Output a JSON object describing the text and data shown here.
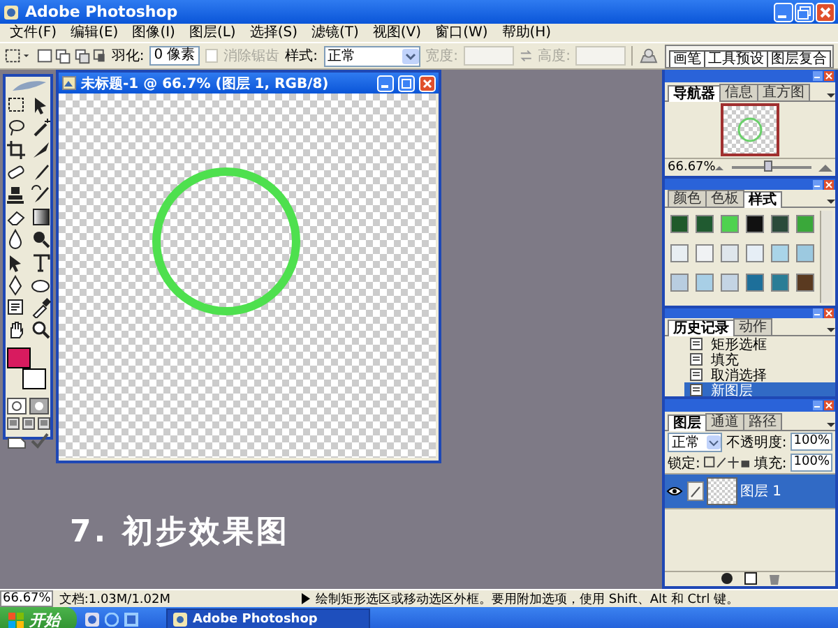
{
  "window": {
    "title": "Adobe Photoshop"
  },
  "menu": [
    "文件(F)",
    "编辑(E)",
    "图像(I)",
    "图层(L)",
    "选择(S)",
    "滤镜(T)",
    "视图(V)",
    "窗口(W)",
    "帮助(H)"
  ],
  "options": {
    "feather_label": "羽化:",
    "feather_value": "0 像素",
    "antialias_label": "消除锯齿",
    "antialias_disabled": true,
    "style_label": "样式:",
    "style_value": "正常",
    "width_label": "宽度:",
    "height_label": "高度:",
    "size_disabled": true,
    "palette_tabs": [
      "画笔",
      "工具预设",
      "图层复合"
    ]
  },
  "toolbox": {
    "colors": [
      {
        "kind": "foreground",
        "color": "#d81b5f"
      },
      {
        "kind": "background",
        "color": "#ffffff"
      }
    ]
  },
  "document": {
    "title": "未标题-1 @ 66.7% (图层 1, RGB/8)"
  },
  "caption": "7. 初步效果图",
  "navigator": {
    "tabs": [
      {
        "label": "导航器",
        "selected": true
      },
      {
        "label": "信息",
        "selected": false
      },
      {
        "label": "直方图",
        "selected": false
      }
    ],
    "zoom": "66.67%",
    "level": 0.45
  },
  "styles": {
    "tabs": [
      {
        "label": "颜色",
        "selected": false
      },
      {
        "label": "色板",
        "selected": false
      },
      {
        "label": "样式",
        "selected": true
      }
    ],
    "swatches": [
      {
        "color": "#1f5a2a"
      },
      {
        "color": "#205a30"
      },
      {
        "color": "#4fd24f"
      },
      {
        "color": "#111111"
      },
      {
        "color": "#2a4a3a"
      },
      {
        "color": "#3aa83a"
      },
      {
        "color": "#e8eef2"
      },
      {
        "color": "#f0f2f4"
      },
      {
        "color": "#dfe6ec"
      },
      {
        "color": "#e6eef6"
      },
      {
        "color": "#a9d4e8"
      },
      {
        "color": "#9cc9e0"
      },
      {
        "color": "#b8cde0"
      },
      {
        "color": "#a8cfe6"
      },
      {
        "color": "#c4d4e4"
      },
      {
        "color": "#1d6f9a"
      },
      {
        "color": "#2a7d96"
      },
      {
        "color": "#5a3a20"
      }
    ]
  },
  "history": {
    "tabs": [
      {
        "label": "历史记录",
        "selected": true
      },
      {
        "label": "动作",
        "selected": false
      }
    ],
    "items": [
      {
        "label": "矩形选框",
        "selected": false
      },
      {
        "label": "填充",
        "selected": false
      },
      {
        "label": "取消选择",
        "selected": false
      },
      {
        "label": "新图层",
        "selected": true
      }
    ]
  },
  "layers": {
    "tabs": [
      {
        "label": "图层",
        "selected": true
      },
      {
        "label": "通道",
        "selected": false
      },
      {
        "label": "路径",
        "selected": false
      }
    ],
    "blend_mode": "正常",
    "opacity_label": "不透明度:",
    "opacity": "100%",
    "lock_label": "锁定:",
    "fill_label": "填充:",
    "fill": "100%",
    "items": [
      {
        "name": "图层 1",
        "selected": true,
        "visible": true
      }
    ]
  },
  "status_bar": {
    "zoom": "66.67%",
    "doc_info": "文档:1.03M/1.02M",
    "hint": "绘制矩形选区或移动选区外框。要用附加选项，使用 Shift、Alt 和 Ctrl 键。"
  },
  "taskbar": {
    "start": "开始",
    "task": "Adobe Photoshop"
  }
}
